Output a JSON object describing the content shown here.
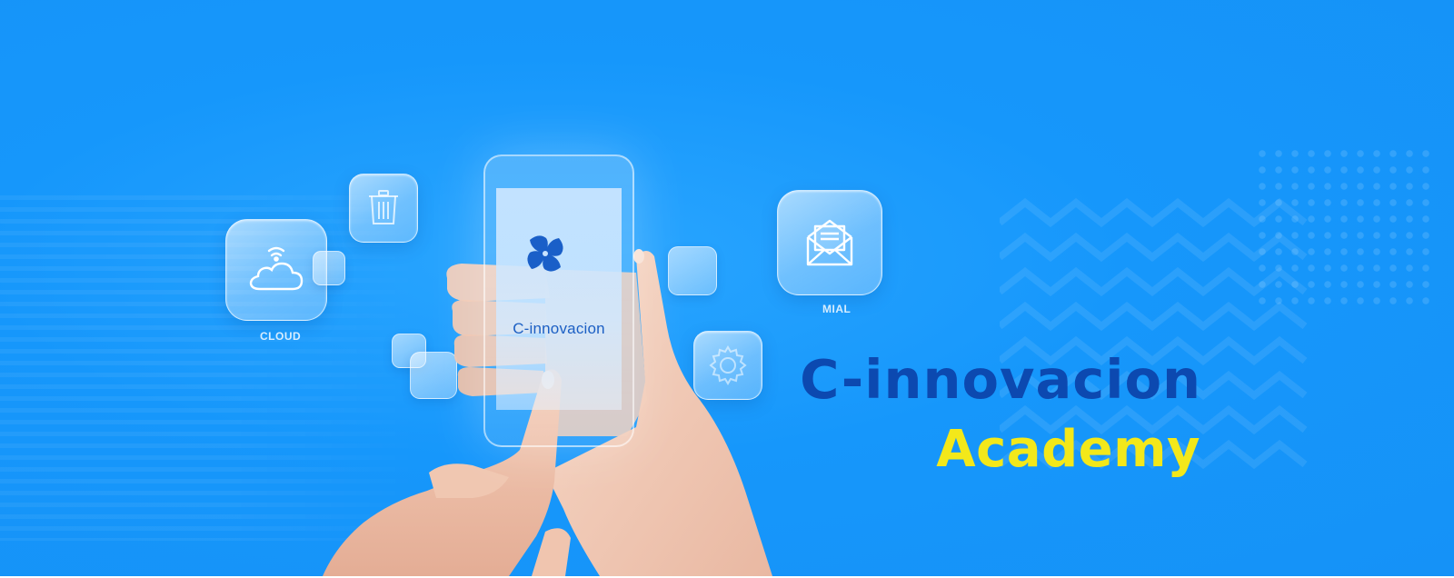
{
  "banner": {
    "background_color": "#1697fb",
    "headline": "C-innovacion",
    "headline_color": "#0c49b0",
    "subline": "Academy",
    "subline_color": "#f3e81a"
  },
  "phone": {
    "brand_label": "C-innovacion",
    "logo_icon": "pinwheel-logo-icon"
  },
  "app_icons": {
    "cloud": {
      "label": "CLOUD",
      "icon": "cloud-wifi-icon"
    },
    "trash": {
      "icon": "trash-icon"
    },
    "mail": {
      "label": "MIAL",
      "icon": "envelope-icon"
    },
    "settings": {
      "icon": "gear-icon"
    }
  }
}
